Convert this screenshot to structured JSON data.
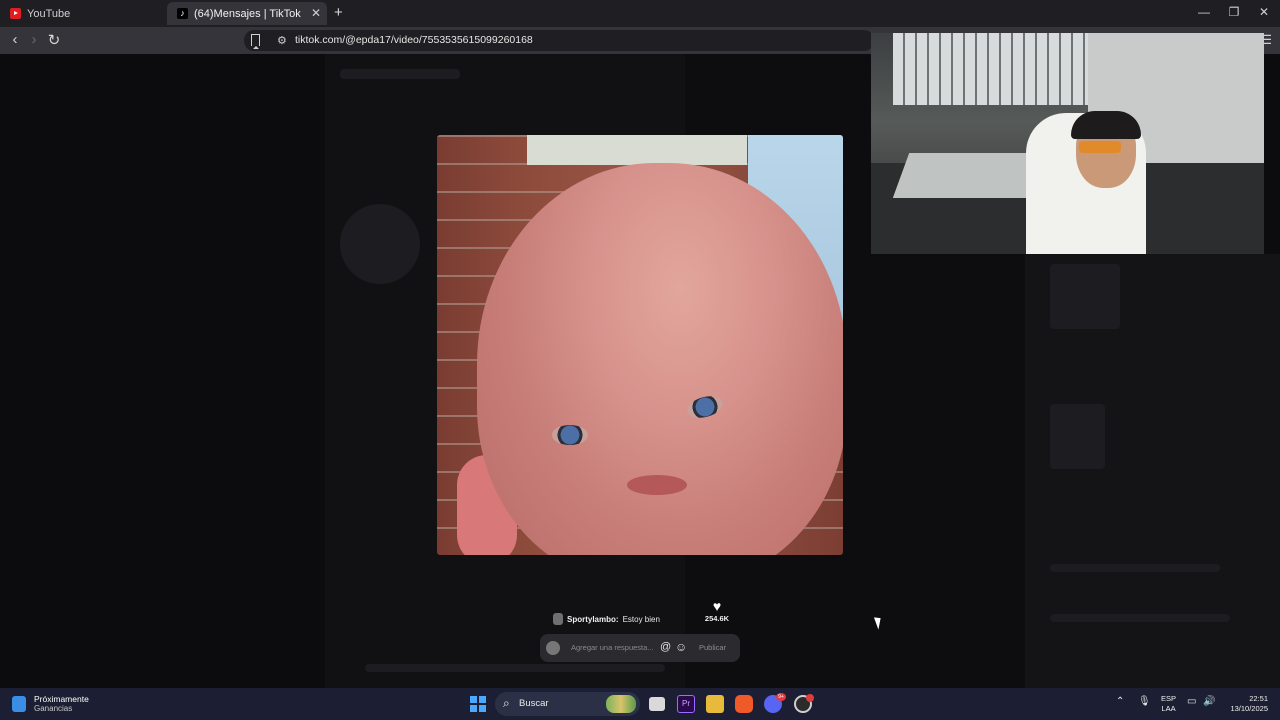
{
  "browser": {
    "tabs": [
      {
        "label": "YouTube",
        "active": false
      },
      {
        "label": "(64)Mensajes | TikTok",
        "active": true
      }
    ],
    "new_tab_label": "+",
    "url": "tiktok.com/@epda17/video/7553535615099260168",
    "window_controls": {
      "minimize": "—",
      "restore": "❐",
      "close": "✕"
    }
  },
  "video_overlay": {
    "reply_user": "Sportylambo:",
    "reply_text": "Estoy bien",
    "like_count": "254.6K",
    "reply_placeholder": "Agregar una respuesta...",
    "at_symbol": "@",
    "publish_label": "Publicar"
  },
  "taskbar": {
    "weather_title": "Próximamente",
    "weather_subtitle": "Ganancias",
    "search_label": "Buscar",
    "lang_top": "ESP",
    "lang_bottom": "LAA",
    "time": "22:51",
    "date": "13/10/2025",
    "discord_badge": "9+"
  },
  "colors": {
    "taskbar": "#1c1f33",
    "tabbar": "#1f1f23",
    "addressbar": "#34343a"
  }
}
